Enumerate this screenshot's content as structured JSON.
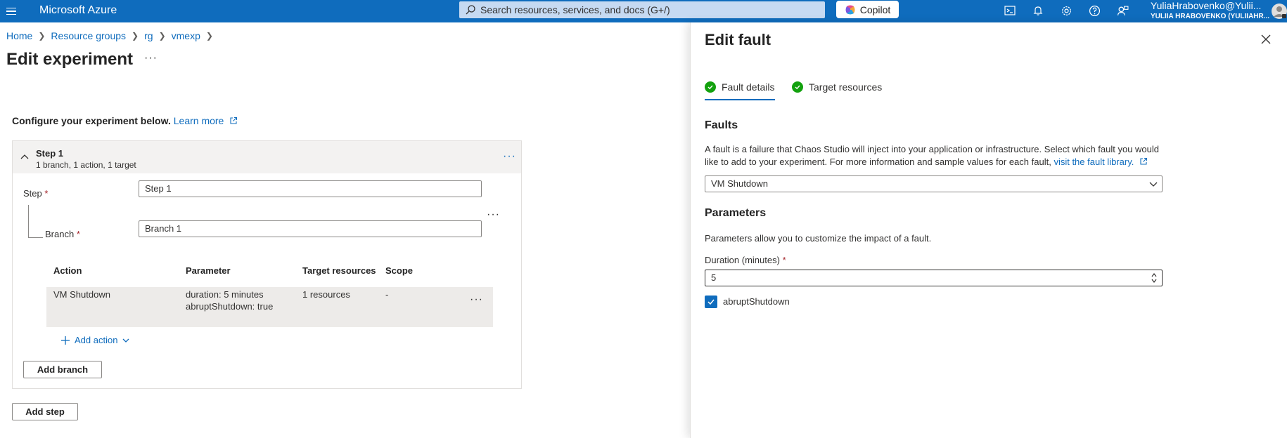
{
  "topbar": {
    "brand": "Microsoft Azure",
    "search_placeholder": "Search resources, services, and docs (G+/)",
    "copilot_label": "Copilot",
    "user_email": "YuliaHrabovenko@Yulii...",
    "user_directory": "YULIIA HRABOVENKO (YULIIAHR...",
    "icons": [
      "hamburger-icon",
      "search-icon",
      "copilot-icon",
      "cloud-shell-icon",
      "bell-icon",
      "gear-icon",
      "help-icon",
      "feedback-icon",
      "avatar"
    ]
  },
  "breadcrumb": [
    "Home",
    "Resource groups",
    "rg",
    "vmexp"
  ],
  "page": {
    "title": "Edit experiment",
    "more": "···",
    "configure_text": "Configure your experiment below.",
    "learn_more": "Learn more"
  },
  "step": {
    "name": "Step 1",
    "summary": "1 branch, 1 action, 1 target",
    "step_label": "Step",
    "step_value": "Step 1",
    "branch_label": "Branch",
    "branch_value": "Branch 1",
    "columns": [
      "Action",
      "Parameter",
      "Target resources",
      "Scope"
    ],
    "rows": [
      {
        "action": "VM Shutdown",
        "param1": "duration: 5 minutes",
        "param2": "abruptShutdown: true",
        "targets": "1 resources",
        "scope": "-"
      }
    ],
    "add_action": "Add action",
    "add_branch": "Add branch"
  },
  "add_step": "Add step",
  "panel": {
    "title": "Edit fault",
    "tabs": [
      "Fault details",
      "Target resources"
    ],
    "faults_heading": "Faults",
    "faults_desc_1": "A fault is a failure that Chaos Studio will inject into your application or infrastructure. Select which fault you would",
    "faults_desc_2": "like to add to your experiment. For more information and sample values for each fault,",
    "fault_library_link": "visit the fault library.",
    "fault_selected": "VM Shutdown",
    "parameters_heading": "Parameters",
    "parameters_desc": "Parameters allow you to customize the impact of a fault.",
    "duration_label": "Duration (minutes)",
    "duration_value": "5",
    "abrupt_label": "abruptShutdown",
    "abrupt_checked": true
  },
  "colors": {
    "accent": "#0f6cbd",
    "success": "#13a10e",
    "required": "#a4262c"
  }
}
